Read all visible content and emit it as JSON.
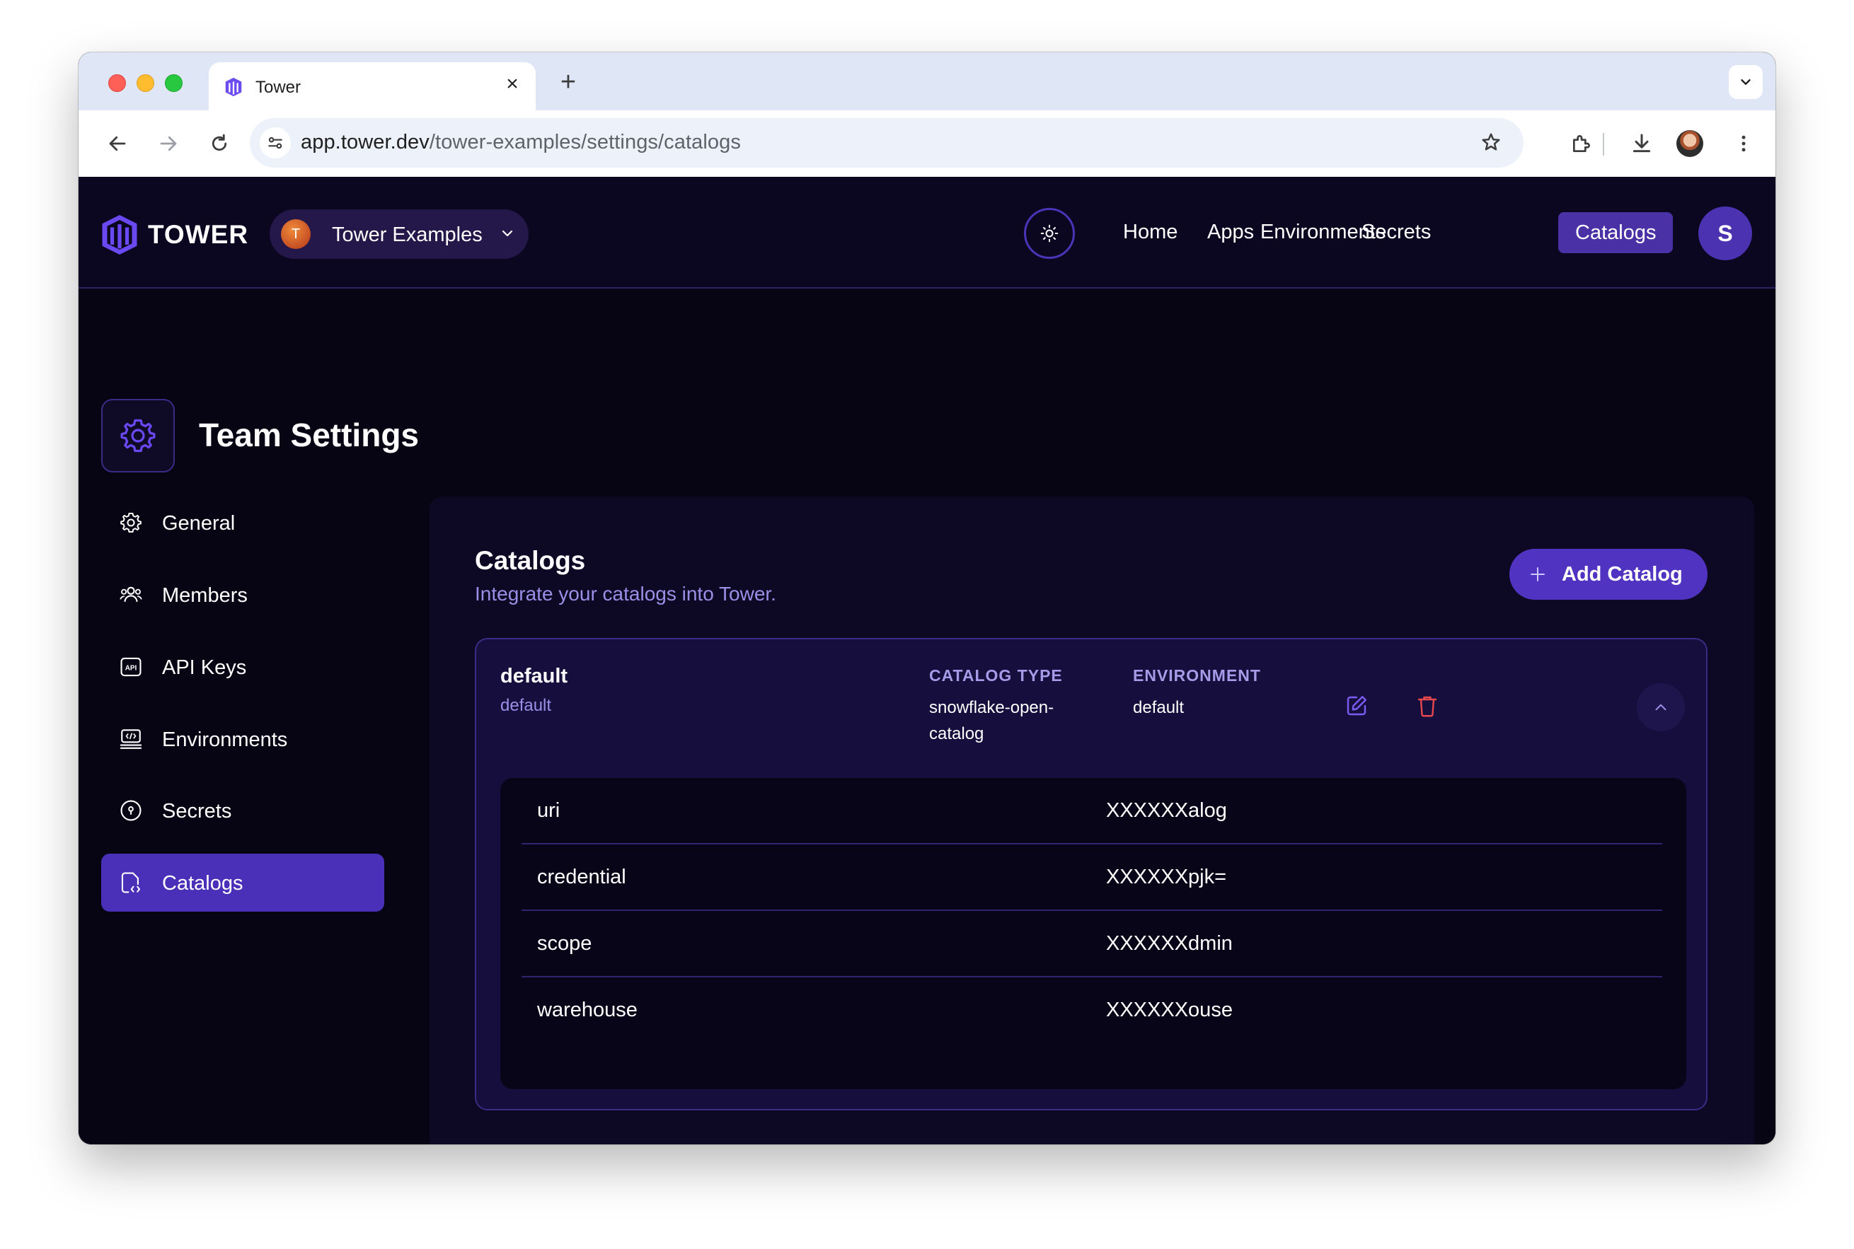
{
  "browser": {
    "tab_title": "Tower",
    "new_tab": "+",
    "url_host": "app.tower.dev",
    "url_path": "/tower-examples/settings/catalogs"
  },
  "header": {
    "logo_text": "TOWER",
    "team": {
      "avatar_letter": "T",
      "name": "Tower Examples"
    },
    "nav": [
      "Home",
      "Apps",
      "Environments",
      "Secrets",
      "Catalogs"
    ],
    "active_nav": "Catalogs",
    "user_initial": "S"
  },
  "settings": {
    "title": "Team Settings",
    "sidebar": [
      {
        "label": "General",
        "icon": "gear-icon"
      },
      {
        "label": "Members",
        "icon": "users-icon"
      },
      {
        "label": "API Keys",
        "icon": "api-icon"
      },
      {
        "label": "Environments",
        "icon": "environment-icon"
      },
      {
        "label": "Secrets",
        "icon": "secret-icon"
      },
      {
        "label": "Catalogs",
        "icon": "catalog-icon",
        "active": true
      }
    ]
  },
  "catalogs": {
    "title": "Catalogs",
    "subtitle": "Integrate your catalogs into Tower.",
    "add_button": "Add Catalog",
    "items": [
      {
        "name": "default",
        "slug": "default",
        "type_header": "CATALOG TYPE",
        "type_value_line1": "snowflake-open-",
        "type_value_line2": "catalog",
        "env_header": "ENVIRONMENT",
        "env_value": "default",
        "properties": [
          {
            "key": "uri",
            "value": "XXXXXXalog"
          },
          {
            "key": "credential",
            "value": "XXXXXXpjk="
          },
          {
            "key": "scope",
            "value": "XXXXXXdmin"
          },
          {
            "key": "warehouse",
            "value": "XXXXXXouse"
          }
        ]
      }
    ]
  },
  "colors": {
    "app_bg": "#070414",
    "accent": "#5133c2",
    "muted_text": "#9a8fe6",
    "delete": "#e5484d"
  }
}
